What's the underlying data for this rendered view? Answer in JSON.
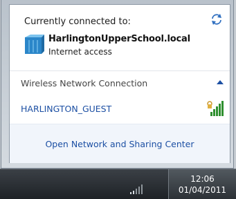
{
  "popup": {
    "connected_title": "Currently connected to:",
    "network_name": "HarlingtonUpperSchool.local",
    "network_status": "Internet access",
    "wireless_section_label": "Wireless Network Connection",
    "networks": [
      {
        "name": "HARLINGTON_GUEST",
        "icon": "wifi-secured-signal-icon"
      }
    ],
    "footer_link": "Open Network and Sharing Center"
  },
  "taskbar": {
    "clock_time": "12:06",
    "clock_date": "01/04/2011"
  },
  "colors": {
    "link_blue": "#1c4fa3",
    "signal_green": "#2f8f2f",
    "footer_bg": "#f1f5fb"
  }
}
